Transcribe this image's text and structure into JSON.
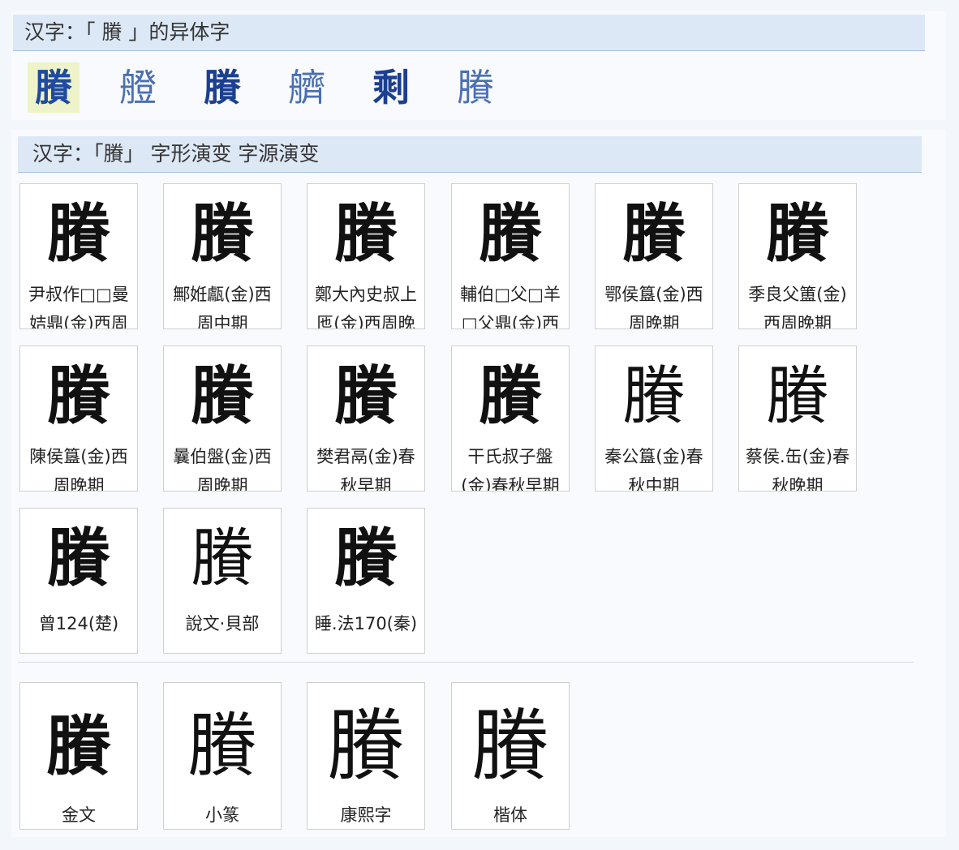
{
  "variants_section": {
    "title": "汉字：「 賸 」的异体字",
    "variants": [
      "賸",
      "艠",
      "賸",
      "艩",
      "剩",
      "賸"
    ]
  },
  "evolution_section": {
    "title": "汉字：「賸」 字形演变 字源演变",
    "row1": [
      {
        "glyph": "賸",
        "caption": "尹叔作□□曼姞鼎(金)西周"
      },
      {
        "glyph": "賸",
        "caption": "鄦姙甗(金)西周中期"
      },
      {
        "glyph": "賸",
        "caption": "鄭大內史叔上匜(金)西周晚"
      },
      {
        "glyph": "賸",
        "caption": "輔伯□父□羊□父鼎(金)西"
      },
      {
        "glyph": "賸",
        "caption": "鄂侯簋(金)西周晚期"
      },
      {
        "glyph": "賸",
        "caption": "季良父簠(金)西周晚期"
      }
    ],
    "row2": [
      {
        "glyph": "賸",
        "caption": "陳侯簋(金)西周晚期"
      },
      {
        "glyph": "賸",
        "caption": "曩伯盤(金)西周晚期"
      },
      {
        "glyph": "賸",
        "caption": "樊君鬲(金)春秋早期"
      },
      {
        "glyph": "賸",
        "caption": "干氏叔子盤(金)春秋早期"
      },
      {
        "glyph": "賸",
        "caption": "秦公簋(金)春秋中期"
      },
      {
        "glyph": "賸",
        "caption": "蔡侯.缶(金)春秋晚期"
      }
    ],
    "row3": [
      {
        "glyph": "賸",
        "caption": "曾124(楚)"
      },
      {
        "glyph": "賸",
        "caption": "說文·貝部"
      },
      {
        "glyph": "賸",
        "caption": "睡.法170(秦)"
      }
    ],
    "standard": [
      {
        "glyph": "賸",
        "caption": "金文"
      },
      {
        "glyph": "賸",
        "caption": "小篆"
      },
      {
        "glyph": "賸",
        "caption": "康熙字"
      },
      {
        "glyph": "賸",
        "caption": "楷体"
      }
    ]
  }
}
